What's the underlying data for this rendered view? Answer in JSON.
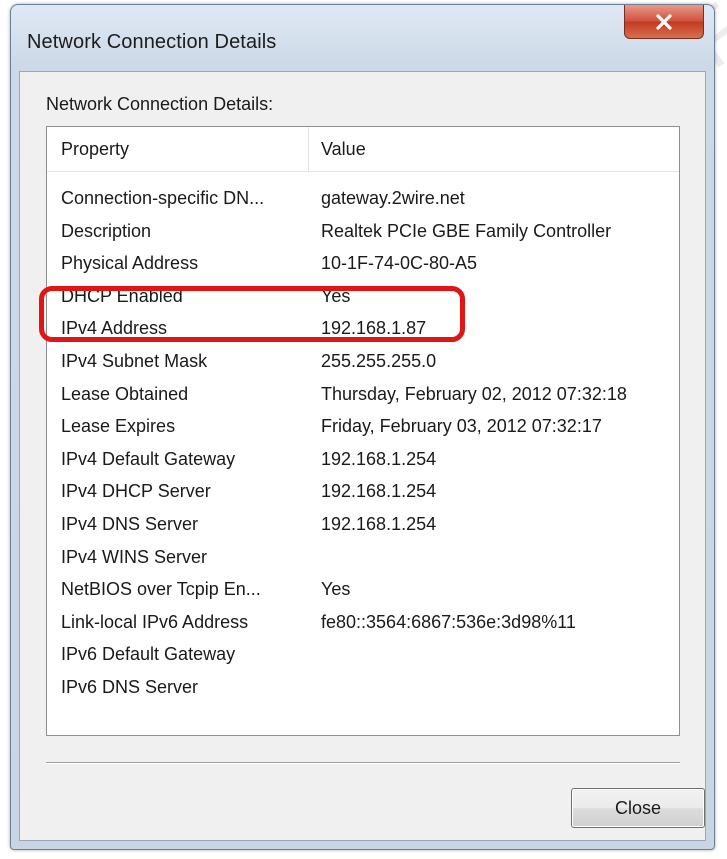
{
  "window": {
    "title": "Network Connection Details",
    "close_glyph": "x",
    "close_icon": "close-icon"
  },
  "group_label": "Network Connection Details:",
  "columns": {
    "property": "Property",
    "value": "Value"
  },
  "rows": [
    {
      "property": "Connection-specific DN...",
      "value": "gateway.2wire.net"
    },
    {
      "property": "Description",
      "value": "Realtek PCIe GBE Family Controller"
    },
    {
      "property": "Physical Address",
      "value": "10-1F-74-0C-80-A5"
    },
    {
      "property": "DHCP Enabled",
      "value": "Yes"
    },
    {
      "property": "IPv4 Address",
      "value": "192.168.1.87"
    },
    {
      "property": "IPv4 Subnet Mask",
      "value": "255.255.255.0"
    },
    {
      "property": "Lease Obtained",
      "value": "Thursday, February 02, 2012 07:32:18"
    },
    {
      "property": "Lease Expires",
      "value": "Friday, February 03, 2012 07:32:17"
    },
    {
      "property": "IPv4 Default Gateway",
      "value": "192.168.1.254"
    },
    {
      "property": "IPv4 DHCP Server",
      "value": "192.168.1.254"
    },
    {
      "property": "IPv4 DNS Server",
      "value": "192.168.1.254"
    },
    {
      "property": "IPv4 WINS Server",
      "value": ""
    },
    {
      "property": "NetBIOS over Tcpip En...",
      "value": "Yes"
    },
    {
      "property": "Link-local IPv6 Address",
      "value": "fe80::3564:6867:536e:3d98%11"
    },
    {
      "property": "IPv6 Default Gateway",
      "value": ""
    },
    {
      "property": "IPv6 DNS Server",
      "value": ""
    }
  ],
  "highlighted_row": "IPv4 Address",
  "highlight_color": "#e01616",
  "close_button_label": "Close",
  "watermark_text": "For F"
}
